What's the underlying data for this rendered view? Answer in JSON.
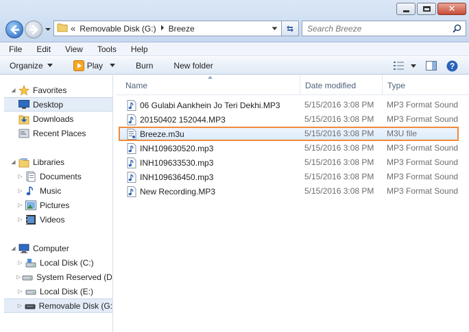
{
  "window": {
    "minimize_glyph": "–",
    "close_glyph": "✕"
  },
  "address_bar": {
    "overflow_glyph": "«",
    "crumbs": [
      "Removable Disk (G:)",
      "Breeze"
    ]
  },
  "search": {
    "placeholder": "Search Breeze"
  },
  "menu": [
    "File",
    "Edit",
    "View",
    "Tools",
    "Help"
  ],
  "toolbar": {
    "organize": "Organize",
    "play": "Play",
    "burn": "Burn",
    "new_folder": "New folder"
  },
  "nav": {
    "favorites": "Favorites",
    "desktop": "Desktop",
    "downloads": "Downloads",
    "recent_places": "Recent Places",
    "libraries": "Libraries",
    "documents": "Documents",
    "music": "Music",
    "pictures": "Pictures",
    "videos": "Videos",
    "computer": "Computer",
    "local_c": "Local Disk (C:)",
    "system_reserved": "System Reserved (D:",
    "local_e": "Local Disk (E:)",
    "removable_g": "Removable Disk (G:)"
  },
  "columns": {
    "name": "Name",
    "date": "Date modified",
    "type": "Type"
  },
  "files": [
    {
      "name": "06 Gulabi Aankhein Jo Teri Dekhi.MP3",
      "date": "5/15/2016 3:08 PM",
      "type": "MP3 Format Sound",
      "icon": "audio-file-icon"
    },
    {
      "name": "20150402 152044.MP3",
      "date": "5/15/2016 3:08 PM",
      "type": "MP3 Format Sound",
      "icon": "audio-file-icon"
    },
    {
      "name": "Breeze.m3u",
      "date": "5/15/2016 3:08 PM",
      "type": "M3U file",
      "icon": "playlist-file-icon",
      "selected": true
    },
    {
      "name": "INH109630520.mp3",
      "date": "5/15/2016 3:08 PM",
      "type": "MP3 Format Sound",
      "icon": "audio-file-icon"
    },
    {
      "name": "INH109633530.mp3",
      "date": "5/15/2016 3:08 PM",
      "type": "MP3 Format Sound",
      "icon": "audio-file-icon"
    },
    {
      "name": "INH109636450.mp3",
      "date": "5/15/2016 3:08 PM",
      "type": "MP3 Format Sound",
      "icon": "audio-file-icon"
    },
    {
      "name": "New Recording.MP3",
      "date": "5/15/2016 3:08 PM",
      "type": "MP3 Format Sound",
      "icon": "audio-file-icon"
    }
  ],
  "colors": {
    "selection_border": "#ef8a3c",
    "header_text": "#4c607a",
    "accent_blue": "#1f5fb8"
  }
}
